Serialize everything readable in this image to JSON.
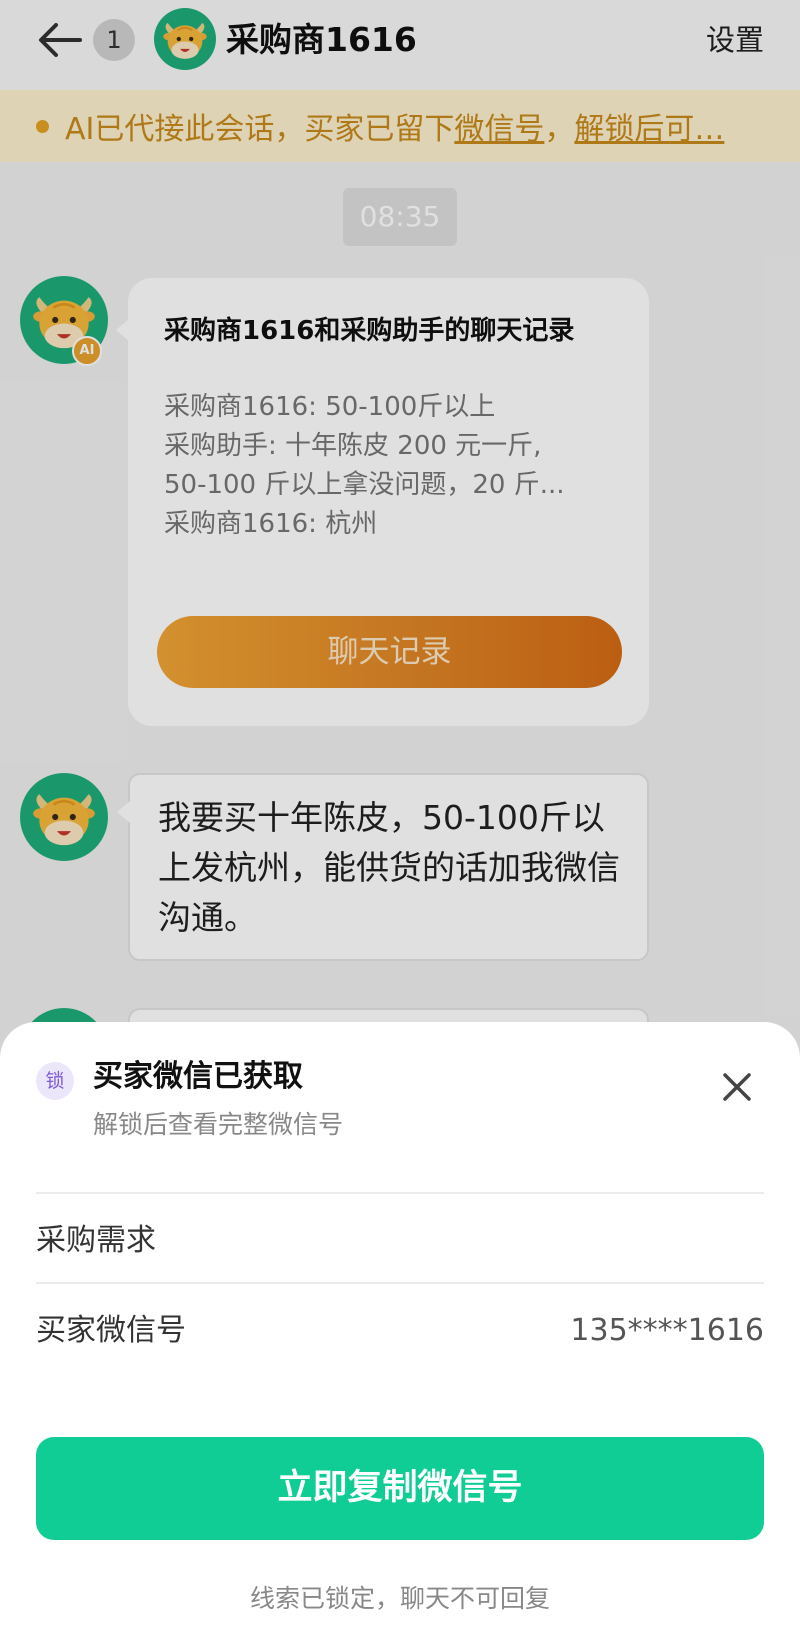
{
  "header": {
    "unread_count": "1",
    "title": "采购商1616",
    "settings_label": "设置"
  },
  "notice": {
    "prefix": "AI已代接此会话，买家已留下",
    "link1": "微信号",
    "sep": "，",
    "link2": "解锁后可…"
  },
  "chat": {
    "time": "08:35",
    "ai_badge": "AI",
    "record_card": {
      "title": "采购商1616和采购助手的聊天记录",
      "lines": [
        "采购商1616: 50-100斤以上",
        "采购助手: 十年陈皮 200 元一斤,",
        "50-100 斤以上拿没问题，20 斤...",
        "采购商1616: 杭州"
      ],
      "button_label": "聊天记录"
    },
    "message": "我要买十年陈皮，50-100斤以上发杭州，能供货的话加我微信沟通。"
  },
  "sheet": {
    "lock_label": "锁",
    "title": "买家微信已获取",
    "subtitle": "解锁后查看完整微信号",
    "rows": [
      {
        "label": "采购需求",
        "value": ""
      },
      {
        "label": "买家微信号",
        "value": "135****1616"
      }
    ],
    "primary_button": "立即复制微信号",
    "footer": "线索已锁定，聊天不可回复"
  },
  "colors": {
    "primary": "#10cc95",
    "notice_bg": "#fdf1cf",
    "notice_text": "#c88a1b",
    "record_button": "#e08626"
  }
}
